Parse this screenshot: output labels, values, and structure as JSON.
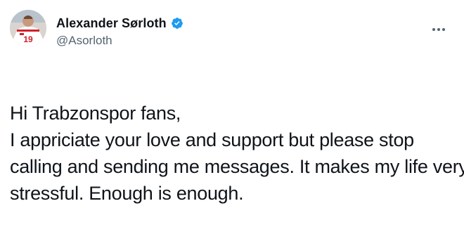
{
  "tweet": {
    "author": {
      "display_name": "Alexander Sørloth",
      "handle": "@Asorloth",
      "verified": true,
      "avatar_icon": "avatar-player-jersey-19"
    },
    "more_icon": "more-horizontal-icon",
    "text_lines": [
      "Hi Trabzonspor fans,",
      "I appriciate your love and support but please stop",
      "calling and sending me messages. It makes my life very",
      "stressful. Enough is enough."
    ]
  },
  "colors": {
    "text": "#0f1419",
    "secondary": "#536471",
    "verified_blue": "#1d9bf0",
    "background": "#ffffff"
  }
}
